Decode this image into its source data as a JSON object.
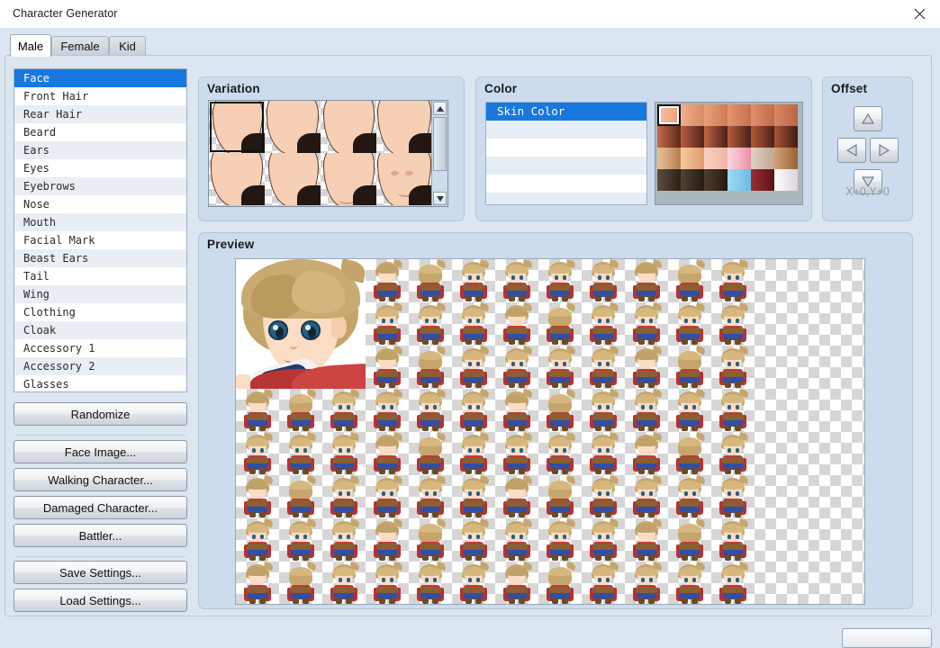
{
  "window": {
    "title": "Character Generator",
    "close_icon": "close-icon"
  },
  "tabs": [
    {
      "label": "Male",
      "active": true
    },
    {
      "label": "Female",
      "active": false
    },
    {
      "label": "Kid",
      "active": false
    }
  ],
  "parts_list": {
    "selected": "Face",
    "items": [
      "Face",
      "Front Hair",
      "Rear Hair",
      "Beard",
      "Ears",
      "Eyes",
      "Eyebrows",
      "Nose",
      "Mouth",
      "Facial Mark",
      "Beast Ears",
      "Tail",
      "Wing",
      "Clothing",
      "Cloak",
      "Accessory 1",
      "Accessory 2",
      "Glasses"
    ]
  },
  "buttons": {
    "randomize": "Randomize",
    "face_image": "Face Image...",
    "walking_character": "Walking Character...",
    "damaged_character": "Damaged Character...",
    "battler": "Battler...",
    "save_settings": "Save Settings...",
    "load_settings": "Load Settings..."
  },
  "variation": {
    "title": "Variation",
    "selected_index": 0,
    "cell_count": 8,
    "scrollbar": {
      "up_icon": "triangle-up-icon",
      "down_icon": "triangle-down-icon"
    }
  },
  "color": {
    "title": "Color",
    "selected": "Skin Color",
    "rows": [
      "Skin Color",
      "",
      "",
      "",
      "",
      ""
    ],
    "palette": {
      "selected_index": 0,
      "columns": 6,
      "rows": 4,
      "swatches": [
        {
          "from": "#f7c4a3",
          "to": "#e99b73"
        },
        {
          "from": "#f0b08d",
          "to": "#d98a63"
        },
        {
          "from": "#e9a07c",
          "to": "#cf7c55"
        },
        {
          "from": "#e29473",
          "to": "#c8714c"
        },
        {
          "from": "#dd8f6e",
          "to": "#c26b47"
        },
        {
          "from": "#d7886a",
          "to": "#bb6541"
        },
        {
          "from": "#c96a4a",
          "to": "#5d2a1b"
        },
        {
          "from": "#b85c3f",
          "to": "#51241a"
        },
        {
          "from": "#c06443",
          "to": "#4d2018"
        },
        {
          "from": "#b95d3e",
          "to": "#472017"
        },
        {
          "from": "#b25838",
          "to": "#4a2118"
        },
        {
          "from": "#ab5234",
          "to": "#3f1c14"
        },
        {
          "from": "#e8c29b",
          "to": "#b77d4f"
        },
        {
          "from": "#f6c9a0",
          "to": "#e09a6e"
        },
        {
          "from": "#f8d2c2",
          "to": "#f0b5a4"
        },
        {
          "from": "#fbd9e2",
          "to": "#ee8fa6"
        },
        {
          "from": "#e2cfc2",
          "to": "#c0a893"
        },
        {
          "from": "#cfa276",
          "to": "#9a6334"
        },
        {
          "from": "#5d4d3c",
          "to": "#2b2118"
        },
        {
          "from": "#514232",
          "to": "#241c14"
        },
        {
          "from": "#4e3c2a",
          "to": "#241a11"
        },
        {
          "from": "#9fd9f2",
          "to": "#69bde4"
        },
        {
          "from": "#9e2c32",
          "to": "#5c1219"
        },
        {
          "from": "#ffffff",
          "to": "#ddd3dd"
        }
      ]
    }
  },
  "offset": {
    "title": "Offset",
    "value_label": "X+0,Y+0",
    "up_icon": "arrow-up-icon",
    "left_icon": "arrow-left-icon",
    "right_icon": "arrow-right-icon",
    "down_icon": "arrow-down-icon"
  },
  "preview": {
    "title": "Preview",
    "face_alt": "blond-character-face-portrait",
    "sprite_grid": {
      "columns": 12,
      "rows": 8
    }
  }
}
